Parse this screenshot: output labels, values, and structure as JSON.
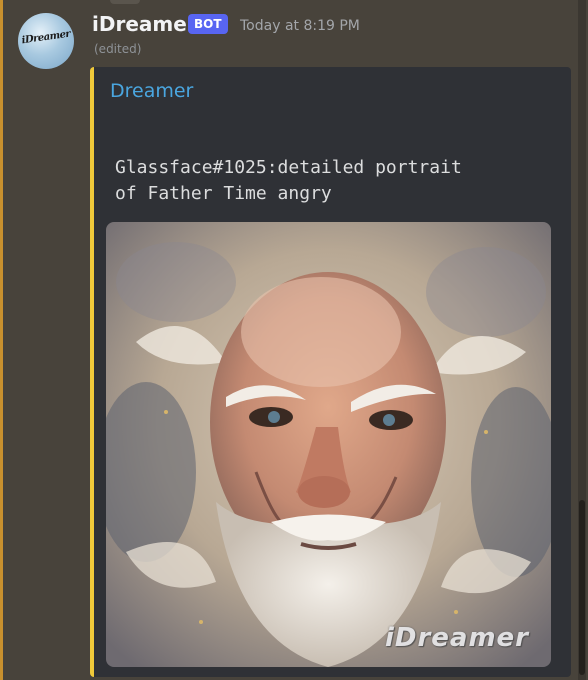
{
  "message": {
    "username": "iDreamer",
    "bot_badge": "BOT",
    "timestamp": "Today at 8:19 PM",
    "edited_label": "(edited)",
    "avatar_text": "iDreamer"
  },
  "embed": {
    "accent_color": "#f0c93a",
    "author": "Dreamer",
    "description": "Glassface#1025:detailed portrait\nof Father Time angry",
    "image_watermark": "iDreamer",
    "image_subject": "painted portrait of an angry old man with white hair and beard"
  },
  "colors": {
    "background": "#48433b",
    "embed_bg": "#2f3136",
    "link": "#4aa6e0",
    "bot_badge": "#5865f2"
  }
}
